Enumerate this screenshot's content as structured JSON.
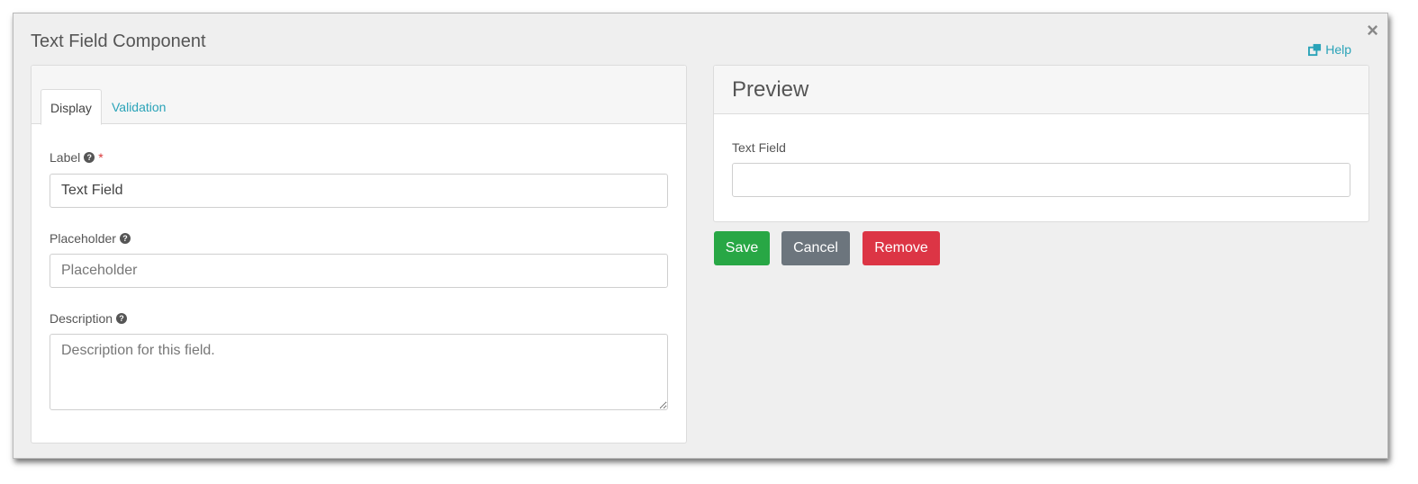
{
  "modal": {
    "title": "Text Field Component",
    "close_label": "×",
    "help_label": "Help"
  },
  "tabs": [
    {
      "label": "Display",
      "active": true
    },
    {
      "label": "Validation",
      "active": false
    }
  ],
  "fields": {
    "label": {
      "label": "Label",
      "required_marker": "*",
      "value": "Text Field"
    },
    "placeholder": {
      "label": "Placeholder",
      "placeholder": "Placeholder"
    },
    "description": {
      "label": "Description",
      "placeholder": "Description for this field."
    }
  },
  "preview": {
    "title": "Preview",
    "field_label": "Text Field"
  },
  "buttons": {
    "save": "Save",
    "cancel": "Cancel",
    "remove": "Remove"
  },
  "colors": {
    "accent": "#2aa3b8",
    "save": "#28a745",
    "cancel": "#6c757d",
    "remove": "#dc3545",
    "required": "#d9383a"
  },
  "icons": {
    "help": "external-window-icon",
    "field_help": "question-circle-icon",
    "close": "close-icon"
  }
}
